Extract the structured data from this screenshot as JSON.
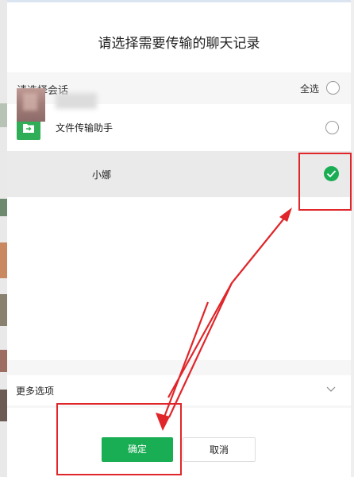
{
  "dialog": {
    "title": "请选择需要传输的聊天记录"
  },
  "header": {
    "label": "请选择会话",
    "select_all": "全选"
  },
  "conversations": [
    {
      "name": "文件传输助手",
      "icon": "folder-transfer-icon",
      "selected": false
    },
    {
      "name": "小娜",
      "icon": "avatar",
      "selected": true
    }
  ],
  "more_options": {
    "label": "更多选项",
    "icon": "chevron-down-icon"
  },
  "buttons": {
    "confirm": "确定",
    "cancel": "取消"
  },
  "colors": {
    "accent": "#1aad54",
    "annotation": "#e0262a"
  }
}
